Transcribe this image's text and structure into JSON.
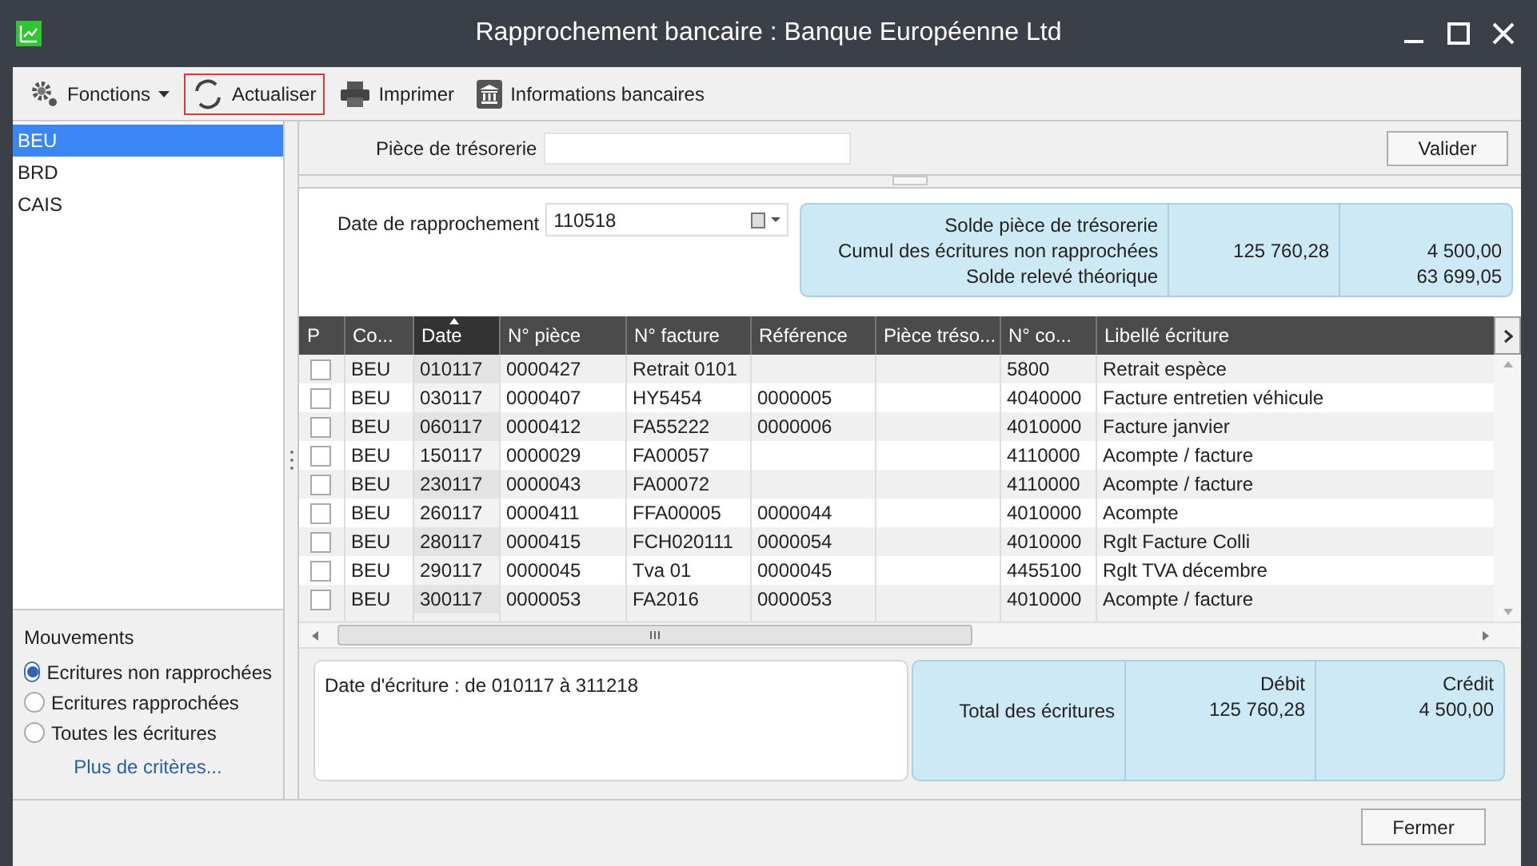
{
  "window": {
    "title": "Rapprochement bancaire : Banque Européenne Ltd"
  },
  "toolbar": [
    {
      "kind": "gear",
      "label": "Fonctions",
      "dropdown": true,
      "focused": false
    },
    {
      "kind": "refresh",
      "label": "Actualiser",
      "dropdown": false,
      "focused": true
    },
    {
      "kind": "printer",
      "label": "Imprimer",
      "dropdown": false,
      "focused": false
    },
    {
      "kind": "bank",
      "label": "Informations bancaires",
      "dropdown": false,
      "focused": false
    }
  ],
  "journals": [
    {
      "label": "BEU",
      "selected": true
    },
    {
      "label": "BRD",
      "selected": false
    },
    {
      "label": "CAIS",
      "selected": false
    }
  ],
  "treasury_field": {
    "label": "Pièce de trésorerie"
  },
  "validate_button": "Valider",
  "reconciliation_date": {
    "label": "Date de rapprochement",
    "value": "110518"
  },
  "summary": [
    {
      "label": "Solde pièce de trésorerie"
    },
    {
      "label": "Cumul des écritures non rapprochées",
      "column_1": "125 760,28",
      "column_2": "4 500,00"
    },
    {
      "label": "Solde relevé théorique",
      "column_2": "63 699,05"
    }
  ],
  "table": {
    "columns": [
      {
        "label": "P",
        "sorted": false
      },
      {
        "label": "Co...",
        "sorted": false
      },
      {
        "label": "Date",
        "sorted": true
      },
      {
        "label": "N° pièce",
        "sorted": false
      },
      {
        "label": "N° facture",
        "sorted": false
      },
      {
        "label": "Référence",
        "sorted": false
      },
      {
        "label": "Pièce tréso...",
        "sorted": false
      },
      {
        "label": "N° co...",
        "sorted": false
      },
      {
        "label": "Libellé écriture",
        "sorted": false
      }
    ],
    "rows": [
      {
        "checked": false,
        "cells": [
          "",
          "BEU",
          "010117",
          "0000427",
          "Retrait 0101",
          "",
          "",
          "5800",
          "Retrait espèce"
        ]
      },
      {
        "checked": false,
        "cells": [
          "",
          "BEU",
          "030117",
          "0000407",
          "HY5454",
          "0000005",
          "",
          "4040000",
          "Facture entretien véhicule"
        ]
      },
      {
        "checked": false,
        "cells": [
          "",
          "BEU",
          "060117",
          "0000412",
          "FA55222",
          "0000006",
          "",
          "4010000",
          "Facture janvier"
        ]
      },
      {
        "checked": false,
        "cells": [
          "",
          "BEU",
          "150117",
          "0000029",
          "FA00057",
          "",
          "",
          "4110000",
          "Acompte / facture"
        ]
      },
      {
        "checked": false,
        "cells": [
          "",
          "BEU",
          "230117",
          "0000043",
          "FA00072",
          "",
          "",
          "4110000",
          "Acompte / facture"
        ]
      },
      {
        "checked": false,
        "cells": [
          "",
          "BEU",
          "260117",
          "0000411",
          "FFA00005",
          "0000044",
          "",
          "4010000",
          "Acompte"
        ]
      },
      {
        "checked": false,
        "cells": [
          "",
          "BEU",
          "280117",
          "0000415",
          "FCH020111",
          "0000054",
          "",
          "4010000",
          "Rglt Facture Colli"
        ]
      },
      {
        "checked": false,
        "cells": [
          "",
          "BEU",
          "290117",
          "0000045",
          "Tva 01",
          "0000045",
          "",
          "4455100",
          "Rglt TVA décembre"
        ]
      },
      {
        "checked": false,
        "cells": [
          "",
          "BEU",
          "300117",
          "0000053",
          "FA2016",
          "0000053",
          "",
          "4010000",
          "Acompte / facture"
        ]
      }
    ]
  },
  "movements": {
    "title": "Mouvements",
    "options": [
      {
        "label": "Ecritures non rapprochées",
        "selected": true
      },
      {
        "label": "Ecritures rapprochées",
        "selected": false
      },
      {
        "label": "Toutes les écritures",
        "selected": false
      }
    ],
    "link": "Plus de critères..."
  },
  "filter_text": "Date d'écriture : de 010117 à 311218",
  "totals": {
    "label": "Total des écritures",
    "debit": {
      "heading": "Débit",
      "value": "125 760,28"
    },
    "credit": {
      "heading": "Crédit",
      "value": "4 500,00"
    }
  },
  "close_button": "Fermer"
}
